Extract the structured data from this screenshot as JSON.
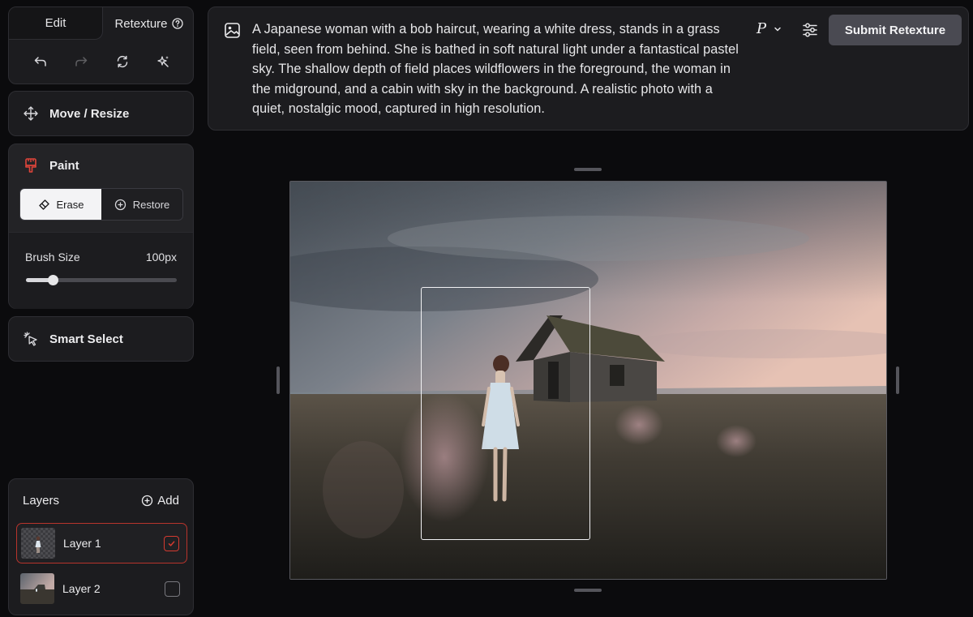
{
  "mode_tabs": {
    "edit": "Edit",
    "retexture": "Retexture"
  },
  "toolbar": [
    "undo-icon",
    "redo-icon",
    "refresh-icon",
    "magic-icon"
  ],
  "tools": {
    "move_resize": "Move / Resize",
    "paint": "Paint",
    "smart_select": "Smart Select"
  },
  "paint": {
    "erase_label": "Erase",
    "restore_label": "Restore",
    "active_mode": "Erase",
    "brush_label": "Brush Size",
    "brush_value": "100px",
    "brush_fraction": 0.18
  },
  "layers": {
    "title": "Layers",
    "add_label": "Add",
    "items": [
      {
        "name": "Layer 1",
        "checked": true,
        "selected": true
      },
      {
        "name": "Layer 2",
        "checked": false,
        "selected": false
      }
    ]
  },
  "prompt": {
    "text": "A Japanese woman with a bob haircut, wearing a white dress, stands in a grass field, seen from behind. She is bathed in soft natural light under a fantastical pastel sky. The shallow depth of field places wildflowers in the foreground, the woman in the midground, and a cabin with sky in the background. A realistic photo with a quiet, nostalgic mood, captured in high resolution.",
    "model_letter": "P",
    "submit_label": "Submit Retexture"
  },
  "colors": {
    "accent_red": "#d33a30",
    "submit_bg": "#4a4a52",
    "panel_bg": "#1c1c1f"
  }
}
